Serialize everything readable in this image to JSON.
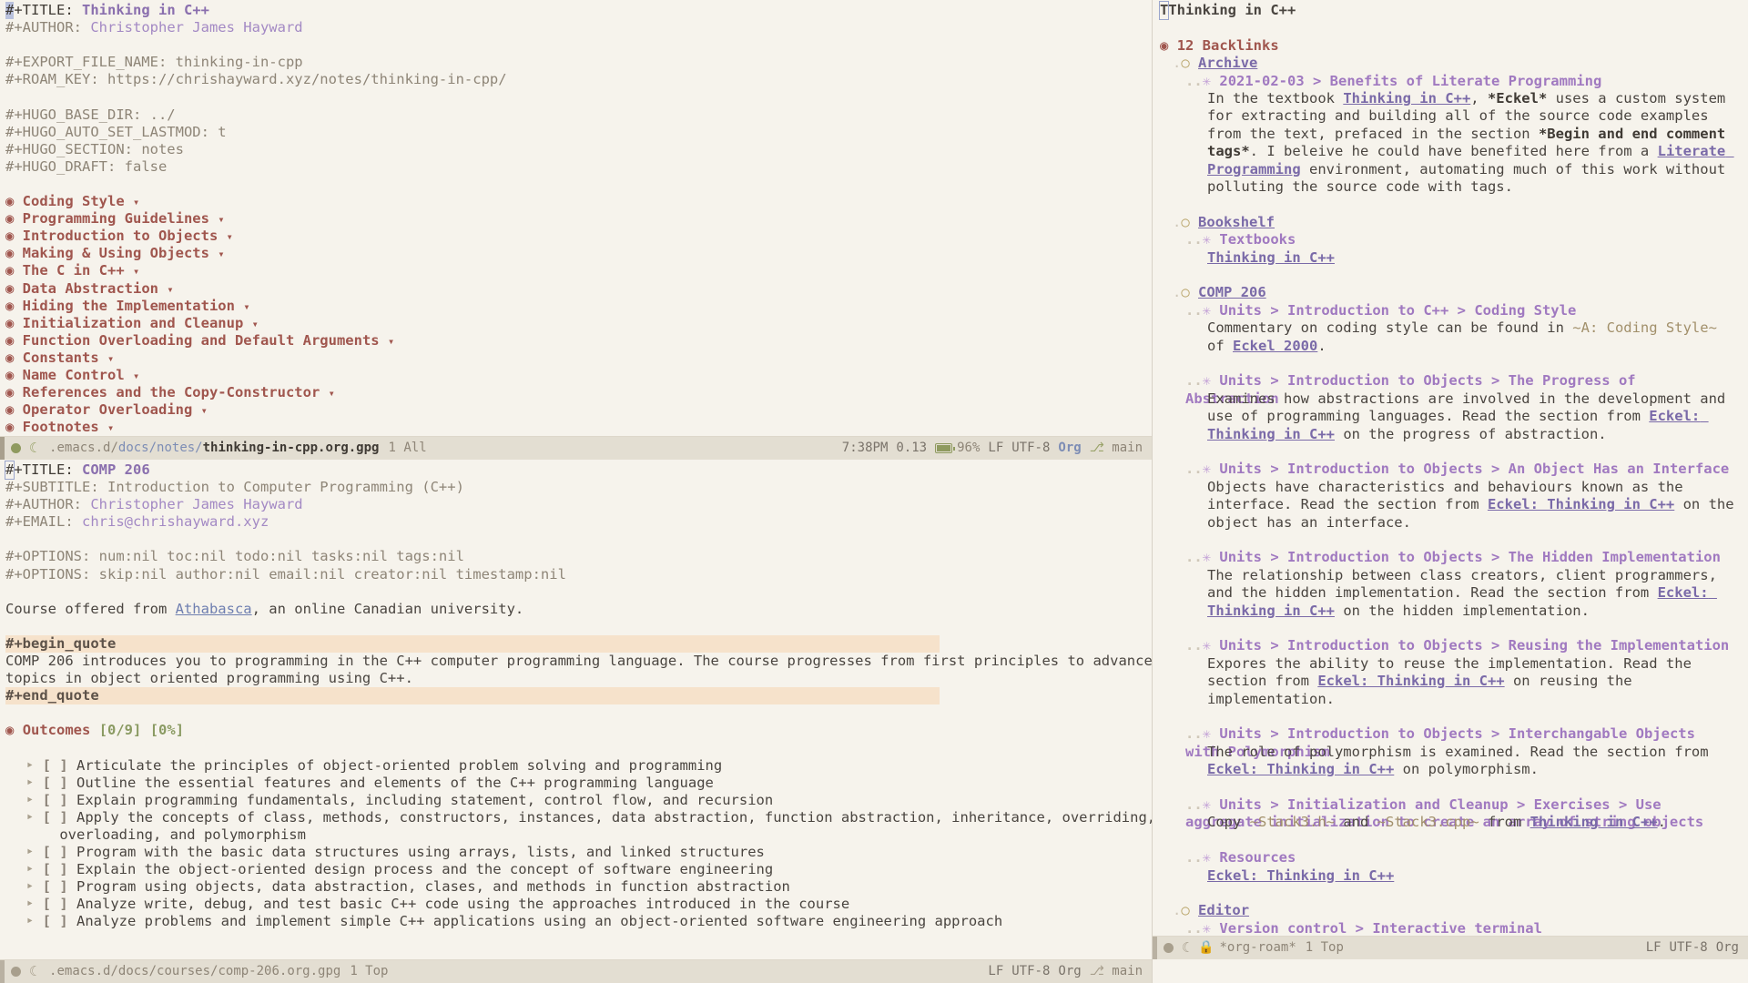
{
  "window_top": {
    "file_header": [
      {
        "key": "#+TITLE:",
        "value": "Thinking in C++",
        "style": "title",
        "cursor": true
      },
      {
        "key": "#+AUTHOR:",
        "value": "Christopher James Hayward",
        "style": "meta"
      }
    ],
    "meta_block_1": [
      {
        "key": "#+EXPORT_FILE_NAME:",
        "value": "thinking-in-cpp"
      },
      {
        "key": "#+ROAM_KEY:",
        "value": "https://chrishayward.xyz/notes/thinking-in-cpp/"
      }
    ],
    "meta_block_2": [
      {
        "key": "#+HUGO_BASE_DIR:",
        "value": "../"
      },
      {
        "key": "#+HUGO_AUTO_SET_LASTMOD:",
        "value": "t"
      },
      {
        "key": "#+HUGO_SECTION:",
        "value": "notes"
      },
      {
        "key": "#+HUGO_DRAFT:",
        "value": "false"
      }
    ],
    "headings": [
      "Coding Style",
      "Programming Guidelines",
      "Introduction to Objects",
      "Making & Using Objects",
      "The C in C++",
      "Data Abstraction",
      "Hiding the Implementation",
      "Initialization and Cleanup",
      "Function Overloading and Default Arguments",
      "Constants",
      "Name Control",
      "References and the Copy-Constructor",
      "Operator Overloading",
      "Footnotes"
    ],
    "modeline": {
      "path_prefix": ".emacs.d/",
      "path_dir": "docs/notes/",
      "path_file": "thinking-in-cpp.org.gpg",
      "position": "1 All",
      "time": "7:38PM",
      "load": "0.13",
      "battery": "96%",
      "eol": "LF",
      "encoding": "UTF-8",
      "major_mode": "Org",
      "branch": "main"
    }
  },
  "window_bottom": {
    "file_header": [
      {
        "key": "#+TITLE:",
        "value": "COMP 206",
        "style": "title",
        "cursor": true
      },
      {
        "key": "#+SUBTITLE:",
        "value": "Introduction to Computer Programming (C++)",
        "style": "dim"
      },
      {
        "key": "#+AUTHOR:",
        "value": "Christopher James Hayward",
        "style": "meta"
      },
      {
        "key": "#+EMAIL:",
        "value": "chris@chrishayward.xyz",
        "style": "meta"
      }
    ],
    "options": [
      {
        "key": "#+OPTIONS:",
        "value": "num:nil toc:nil todo:nil tasks:nil tags:nil"
      },
      {
        "key": "#+OPTIONS:",
        "value": "skip:nil author:nil email:nil creator:nil timestamp:nil"
      }
    ],
    "intro": {
      "before": "Course offered from ",
      "link": "Athabasca",
      "after": ", an online Canadian university."
    },
    "quote": {
      "begin": "#+begin_quote",
      "end": "#+end_quote",
      "lines": [
        "COMP 206 introduces you to programming in the C++ computer programming language. The course progresses from first principles to advanced",
        "topics in object oriented programming using C++."
      ]
    },
    "outcomes": {
      "heading": "Outcomes",
      "cookie_count": "[0/9]",
      "cookie_pct": "[0%]",
      "items": [
        "Articulate the principles of object-oriented problem solving and programming",
        "Outline the essential features and elements of the C++ programming language",
        "Explain programming fundamentals, including statement, control flow, and recursion",
        "Apply the concepts of class, methods, constructors, instances, data abstraction, function abstraction, inheritance, overriding,\n    overloading, and polymorphism",
        "Program with the basic data structures using arrays, lists, and linked structures",
        "Explain the object-oriented design process and the concept of software engineering",
        "Program using objects, data abstraction, clases, and methods in function abstraction",
        "Analyze write, debug, and test basic C++ code using the approaches introduced in the course",
        "Analyze problems and implement simple C++ applications using an object-oriented software engineering approach"
      ],
      "checkbox": "[ ]",
      "bullet": "‣"
    },
    "modeline": {
      "path_prefix": ".emacs.d/",
      "path_dir": "docs/courses/",
      "path_file": "comp-206.org.gpg",
      "position": "1 Top",
      "eol": "LF",
      "encoding": "UTF-8",
      "major_mode": "Org",
      "branch": "main"
    }
  },
  "roam": {
    "title": "Thinking in C++",
    "backlinks_heading": "12 Backlinks",
    "groups": [
      {
        "name": "Archive",
        "entries": [
          {
            "heading": "2021-02-03 > Benefits of Literate Programming",
            "body": [
              {
                "t": "text",
                "v": "In the textbook "
              },
              {
                "t": "link",
                "v": "Thinking in C++"
              },
              {
                "t": "text",
                "v": ", "
              },
              {
                "t": "bold",
                "v": "*Eckel*"
              },
              {
                "t": "text",
                "v": " uses a custom system for extracting and building all of the source code examples from the text, prefaced in the section "
              },
              {
                "t": "bold",
                "v": "*Begin and end comment tags*"
              },
              {
                "t": "text",
                "v": ". I beleive he could have benefited here from a "
              },
              {
                "t": "link",
                "v": "Literate Programming"
              },
              {
                "t": "text",
                "v": " environment, automating much of this work without polluting the source code with tags."
              }
            ]
          }
        ]
      },
      {
        "name": "Bookshelf",
        "entries": [
          {
            "heading": "Textbooks",
            "body": [
              {
                "t": "link",
                "v": "Thinking in C++"
              }
            ]
          }
        ]
      },
      {
        "name": "COMP 206",
        "entries": [
          {
            "heading": "Units > Introduction to C++ > Coding Style",
            "body": [
              {
                "t": "text",
                "v": "Commentary on coding style can be found in "
              },
              {
                "t": "verbatim",
                "v": "~A: Coding Style~"
              },
              {
                "t": "text",
                "v": " of "
              },
              {
                "t": "link",
                "v": "Eckel 2000"
              },
              {
                "t": "text",
                "v": "."
              }
            ]
          },
          {
            "heading": "Units > Introduction to Objects > The Progress of Abstraction",
            "body": [
              {
                "t": "text",
                "v": "Examines how abstractions are involved in the development and use of programming languages. Read the section from "
              },
              {
                "t": "link",
                "v": "Eckel: Thinking in C++"
              },
              {
                "t": "text",
                "v": " on the progress of abstraction."
              }
            ]
          },
          {
            "heading": "Units > Introduction to Objects > An Object Has an Interface",
            "body": [
              {
                "t": "text",
                "v": "Objects have characteristics and behaviours known as the interface. Read the section from "
              },
              {
                "t": "link",
                "v": "Eckel: Thinking in C++"
              },
              {
                "t": "text",
                "v": " on the object has an interface."
              }
            ]
          },
          {
            "heading": "Units > Introduction to Objects > The Hidden Implementation",
            "body": [
              {
                "t": "text",
                "v": "The relationship between class creators, client programmers, and the hidden implementation. Read the section from "
              },
              {
                "t": "link",
                "v": "Eckel: Thinking in C++"
              },
              {
                "t": "text",
                "v": " on the hidden implementation."
              }
            ]
          },
          {
            "heading": "Units > Introduction to Objects > Reusing the Implementation",
            "body": [
              {
                "t": "text",
                "v": "Expores the ability to reuse the implementation. Read the section from "
              },
              {
                "t": "link",
                "v": "Eckel: Thinking in C++"
              },
              {
                "t": "text",
                "v": " on reusing the implementation."
              }
            ]
          },
          {
            "heading": "Units > Introduction to Objects > Interchangable Objects with Polymorphism",
            "body": [
              {
                "t": "text",
                "v": "The role of polymorphism is examined. Read the section from "
              },
              {
                "t": "link",
                "v": "Eckel: Thinking in C++"
              },
              {
                "t": "text",
                "v": " on polymorphism."
              }
            ]
          },
          {
            "heading": "Units > Initialization and Cleanup > Exercises > Use aggregate initialization to create an array of string objects",
            "body": [
              {
                "t": "text",
                "v": "Copy "
              },
              {
                "t": "verbatim",
                "v": "~Stack3.h~"
              },
              {
                "t": "text",
                "v": " and "
              },
              {
                "t": "verbatim",
                "v": "~Stack3.cpp~"
              },
              {
                "t": "text",
                "v": " from "
              },
              {
                "t": "link",
                "v": "Thinking in C++"
              },
              {
                "t": "text",
                "v": "."
              }
            ]
          },
          {
            "heading": "Resources",
            "body": [
              {
                "t": "link",
                "v": "Eckel: Thinking in C++"
              }
            ]
          }
        ]
      },
      {
        "name": "Editor",
        "entries": [
          {
            "heading": "Version control > Interactive terminal",
            "body": []
          }
        ]
      }
    ],
    "modeline": {
      "buffer_name": "*org-roam*",
      "position": "1 Top",
      "eol": "LF",
      "encoding": "UTF-8",
      "major_mode": "Org"
    }
  },
  "icons": {
    "org_bullet": "◉",
    "roam_bullet_l1": "◉",
    "roam_bullet_l2": "○",
    "roam_bullet_l3": "✳",
    "fold_arrow": "▾",
    "evil_state": "☾",
    "lock": "🔒",
    "git": "⎇"
  },
  "colors": {
    "background": "#f6f3ec",
    "modeline_bg": "#e3ded2",
    "heading": "#a0564e",
    "link": "#6f7fb0",
    "roam_heading": "#a079c0",
    "quote_band": "#f6e2cb",
    "accent_green": "#8f9a5f"
  }
}
